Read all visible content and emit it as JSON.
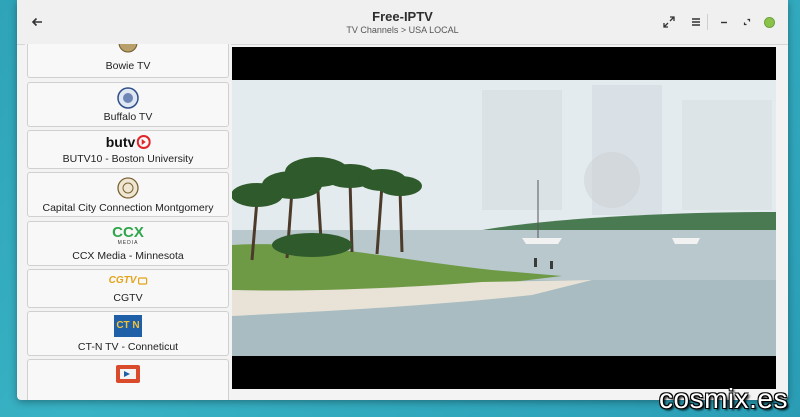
{
  "header": {
    "title": "Free-IPTV",
    "breadcrumb": "TV Channels > USA LOCAL"
  },
  "icons": {
    "back": "left-arrow-icon",
    "expand": "fullscreen-icon",
    "menu": "hamburger-menu-icon",
    "minimize": "minimize-icon",
    "maximize": "maximize-icon",
    "close": "close-icon"
  },
  "channels": [
    {
      "name": "Bowie TV",
      "logo": "city-seal"
    },
    {
      "name": "Buffalo TV",
      "logo": "city-seal"
    },
    {
      "name": "BUTV10 - Boston University",
      "logo": "butv",
      "logo_text": "butv"
    },
    {
      "name": "Capital City Connection Montgomery",
      "logo": "city-seal"
    },
    {
      "name": "CCX Media - Minnesota",
      "logo": "ccx",
      "logo_text": "CCX",
      "logo_sub": "MEDIA"
    },
    {
      "name": "CGTV",
      "logo": "cgtv",
      "logo_text": "CGTV"
    },
    {
      "name": "CT-N TV  - Conneticut",
      "logo": "ctn",
      "logo_text": "CT N"
    },
    {
      "name": "",
      "logo": "generic"
    }
  ],
  "watermark": "cosmix.es",
  "colors": {
    "close_button": "#8bc34a",
    "ccx_green": "#2fa64b",
    "butv_red": "#e0262b",
    "cgtv_gold": "#e3a316"
  }
}
